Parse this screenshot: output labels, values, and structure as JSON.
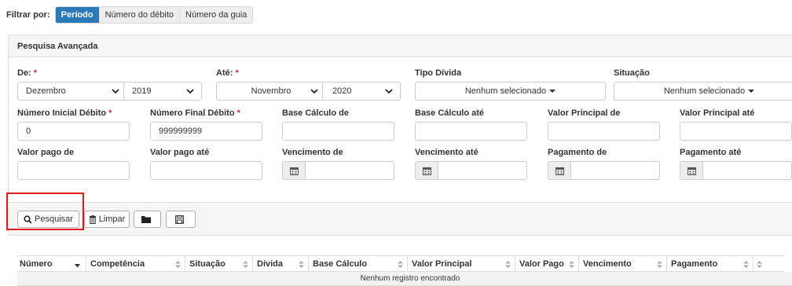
{
  "filter": {
    "label": "Filtrar por:",
    "options": [
      "Período",
      "Número do débito",
      "Número da guia"
    ],
    "active": "Período"
  },
  "panel": {
    "title": "Pesquisa Avançada"
  },
  "form": {
    "de_label": "De:",
    "ate_label": "Até:",
    "required_mark": "*",
    "de_month": "Dezembro",
    "de_year": "2019",
    "ate_month": "Novembro",
    "ate_year": "2020",
    "tipo_divida_label": "Tipo Dívida",
    "tipo_divida_value": "Nenhum selecionado",
    "situacao_label": "Situação",
    "situacao_value": "Nenhum selecionado",
    "numero_inicial_label": "Número Inicial Débito",
    "numero_inicial_value": "0",
    "numero_final_label": "Número Final Débito",
    "numero_final_value": "999999999",
    "base_calculo_de_label": "Base Cálculo de",
    "base_calculo_ate_label": "Base Cálculo até",
    "valor_principal_de_label": "Valor Principal de",
    "valor_principal_ate_label": "Valor Principal até",
    "valor_pago_de_label": "Valor pago de",
    "valor_pago_ate_label": "Valor pago até",
    "vencimento_de_label": "Vencimento de",
    "vencimento_ate_label": "Vencimento até",
    "pagamento_de_label": "Pagamento de",
    "pagamento_ate_label": "Pagamento até"
  },
  "actions": {
    "pesquisar": "Pesquisar",
    "limpar": "Limpar"
  },
  "table": {
    "columns": [
      "Número",
      "Competência",
      "Situação",
      "Dívida",
      "Base Cálculo",
      "Valor Principal",
      "Valor Pago",
      "Vencimento",
      "Pagamento"
    ],
    "empty_message": "Nenhum registro encontrado"
  },
  "colors": {
    "accent": "#2a7ab8",
    "highlight": "#e01b1b",
    "required": "#c9302c"
  }
}
